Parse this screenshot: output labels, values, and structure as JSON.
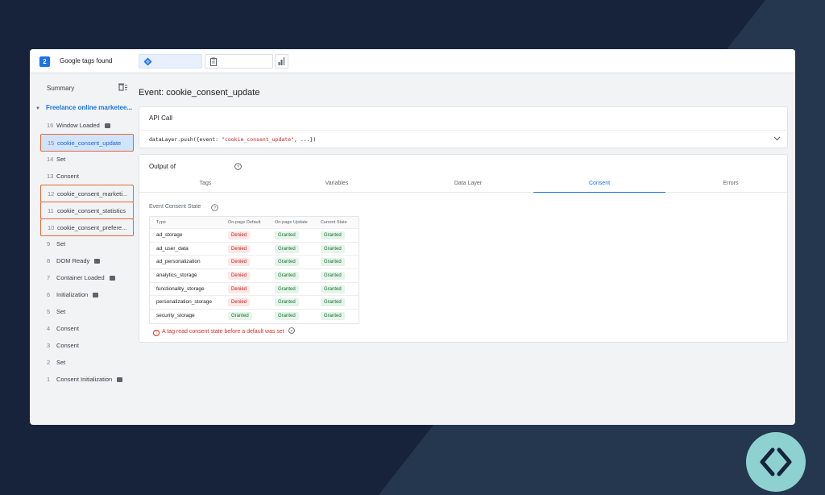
{
  "topbar": {
    "tag_count": "2",
    "tags_found_label": "Google tags found",
    "tabs": [
      {
        "icon": "tag-manager-diamond-icon",
        "active": true
      },
      {
        "icon": "clipboard-icon",
        "active": false
      },
      {
        "icon": "bar-chart-icon",
        "active": false
      }
    ]
  },
  "sidebar": {
    "summary_label": "Summary",
    "container_label": "Freelance online marketee...",
    "events": [
      {
        "num": "16",
        "label": "Window Loaded",
        "icon": true
      },
      {
        "num": "15",
        "label": "cookie_consent_update",
        "selected": true,
        "highlight": true
      },
      {
        "num": "14",
        "label": "Set"
      },
      {
        "num": "13",
        "label": "Consent"
      },
      {
        "num": "12",
        "label": "cookie_consent_marketi...",
        "highlight": true
      },
      {
        "num": "11",
        "label": "cookie_consent_statistics",
        "highlight": true
      },
      {
        "num": "10",
        "label": "cookie_consent_prefere...",
        "highlight": true
      },
      {
        "num": "9",
        "label": "Set"
      },
      {
        "num": "8",
        "label": "DOM Ready",
        "icon": true
      },
      {
        "num": "7",
        "label": "Container Loaded",
        "icon": true
      },
      {
        "num": "6",
        "label": "Initialization",
        "icon": true
      },
      {
        "num": "5",
        "label": "Set"
      },
      {
        "num": "4",
        "label": "Consent"
      },
      {
        "num": "3",
        "label": "Consent"
      },
      {
        "num": "2",
        "label": "Set"
      },
      {
        "num": "1",
        "label": "Consent Initialization",
        "icon": true
      }
    ]
  },
  "main": {
    "event_title": "Event: cookie_consent_update",
    "api_call": {
      "title": "API Call",
      "code_prefix": "dataLayer.push({event: ",
      "code_string": "\"cookie_consent_update\"",
      "code_suffix": ", ...})"
    },
    "output": {
      "title": "Output of",
      "tabs": [
        "Tags",
        "Variables",
        "Data Layer",
        "Consent",
        "Errors"
      ],
      "active_tab": "Consent",
      "section_label": "Event Consent State",
      "columns": [
        "Type",
        "On-page Default",
        "On-page Update",
        "Current State"
      ],
      "rows": [
        {
          "type": "ad_storage",
          "default": "Denied",
          "update": "Granted",
          "current": "Granted"
        },
        {
          "type": "ad_user_data",
          "default": "Denied",
          "update": "Granted",
          "current": "Granted"
        },
        {
          "type": "ad_personalization",
          "default": "Denied",
          "update": "Granted",
          "current": "Granted"
        },
        {
          "type": "analytics_storage",
          "default": "Denied",
          "update": "Granted",
          "current": "Granted"
        },
        {
          "type": "functionality_storage",
          "default": "Denied",
          "update": "Granted",
          "current": "Granted"
        },
        {
          "type": "personalization_storage",
          "default": "Denied",
          "update": "Granted",
          "current": "Granted"
        },
        {
          "type": "security_storage",
          "default": "Granted",
          "update": "Granted",
          "current": "Granted"
        }
      ],
      "warning": "A tag read consent state before a default was set"
    }
  },
  "colors": {
    "background": "#16233b",
    "accent": "#1a73e8",
    "highlight_border": "#e36b3b",
    "denied": "#c5221f",
    "granted": "#137333",
    "logo": "#8ed1d1"
  }
}
